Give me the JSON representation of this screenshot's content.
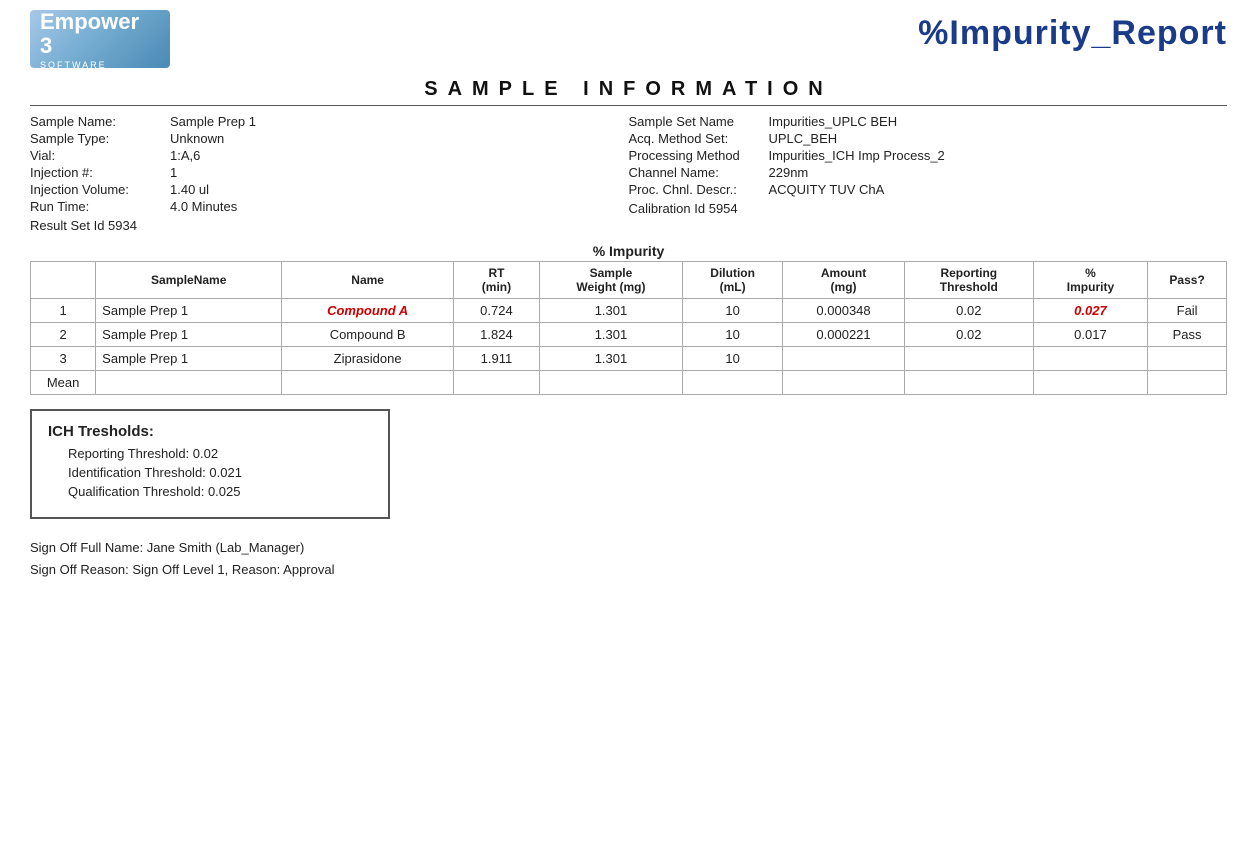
{
  "header": {
    "logo": {
      "title": "Empower 3",
      "subtitle": "SOFTWARE"
    },
    "report_title": "%Impurity_Report"
  },
  "section_title": "SAMPLE   INFORMATION",
  "sample_info": {
    "left": [
      {
        "label": "Sample Name:",
        "value": "Sample Prep 1"
      },
      {
        "label": "Sample Type:",
        "value": "Unknown"
      },
      {
        "label": "Vial:",
        "value": "1:A,6"
      },
      {
        "label": "Injection #:",
        "value": "1"
      },
      {
        "label": "Injection Volume:",
        "value": "1.40 ul"
      },
      {
        "label": "Run Time:",
        "value": "4.0 Minutes"
      }
    ],
    "right": [
      {
        "label": "Sample Set Name",
        "value": "Impurities_UPLC BEH"
      },
      {
        "label": "Acq. Method Set:",
        "value": "UPLC_BEH"
      },
      {
        "label": "Processing Method",
        "value": "Impurities_ICH Imp Process_2"
      },
      {
        "label": "Channel Name:",
        "value": "229nm"
      },
      {
        "label": "Proc. Chnl. Descr.:",
        "value": "ACQUITY TUV ChA"
      }
    ],
    "result_set": "Result Set Id 5934",
    "calibration": "Calibration Id 5954"
  },
  "table": {
    "section_title": "% Impurity",
    "columns": [
      "",
      "SampleName",
      "Name",
      "RT\n(min)",
      "Sample\nWeight (mg)",
      "Dilution\n(mL)",
      "Amount\n(mg)",
      "Reporting\nThreshold",
      "%\nImpurity",
      "Pass?"
    ],
    "rows": [
      {
        "num": "1",
        "sample_name": "Sample Prep 1",
        "name": "Compound A",
        "name_highlight": true,
        "rt": "0.724",
        "weight": "1.301",
        "dilution": "10",
        "amount": "0.000348",
        "threshold": "0.02",
        "impurity": "0.027",
        "impurity_highlight": true,
        "pass": "Fail"
      },
      {
        "num": "2",
        "sample_name": "Sample Prep 1",
        "name": "Compound B",
        "name_highlight": false,
        "rt": "1.824",
        "weight": "1.301",
        "dilution": "10",
        "amount": "0.000221",
        "threshold": "0.02",
        "impurity": "0.017",
        "impurity_highlight": false,
        "pass": "Pass"
      },
      {
        "num": "3",
        "sample_name": "Sample Prep 1",
        "name": "Ziprasidone",
        "name_highlight": false,
        "rt": "1.911",
        "weight": "1.301",
        "dilution": "10",
        "amount": "",
        "threshold": "",
        "impurity": "",
        "impurity_highlight": false,
        "pass": ""
      },
      {
        "num": "Mean",
        "sample_name": "",
        "name": "",
        "name_highlight": false,
        "rt": "",
        "weight": "",
        "dilution": "",
        "amount": "",
        "threshold": "",
        "impurity": "",
        "impurity_highlight": false,
        "pass": ""
      }
    ]
  },
  "ich": {
    "title": "ICH Tresholds:",
    "rows": [
      "Reporting Threshold:  0.02",
      "Identification Threshold:  0.021",
      "Qualification Threshold:  0.025"
    ]
  },
  "sign_off": {
    "line1": "Sign Off Full Name:  Jane Smith (Lab_Manager)",
    "line2": "Sign Off Reason:  Sign Off Level 1, Reason: Approval"
  }
}
